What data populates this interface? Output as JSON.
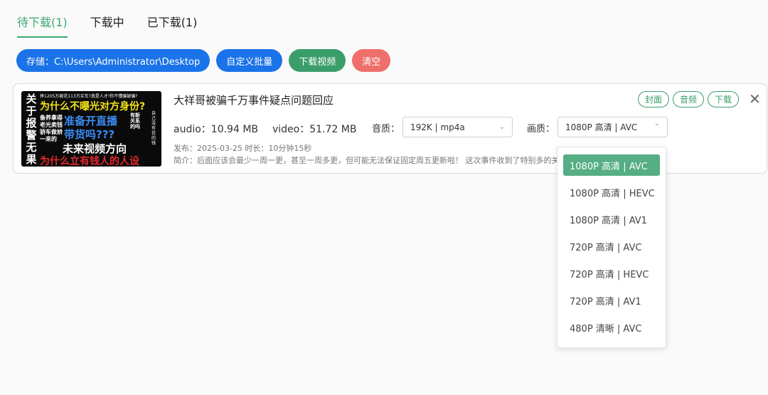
{
  "tabs": [
    {
      "label": "待下载(1)",
      "active": true
    },
    {
      "label": "下载中",
      "active": false
    },
    {
      "label": "已下载(1)",
      "active": false
    }
  ],
  "toolbar": {
    "storage_label": "存储：C:\\Users\\Administrator\\Desktop",
    "batch_label": "自定义批量",
    "download_label": "下载视频",
    "clear_label": "清空"
  },
  "item": {
    "title": "大祥哥被骗千万事件疑点问题回应",
    "tags": {
      "cover": "封面",
      "audio": "音频",
      "download": "下载"
    },
    "audio_size": "audio：10.94 MB",
    "video_size": "video：51.72 MB",
    "audio_quality_label": "音质：",
    "audio_quality_value": "192K | mp4a",
    "video_quality_label": "画质：",
    "video_quality_value": "1080P 高清 | AVC",
    "meta": "发布：2025-03-25 时长：10分钟15秒",
    "description": "简介：后面应该会最少一周一更，甚至一周多更，但可能无法保证固定周五更新啦！ 这次事件收到了特别多的关注和讨论，真的…",
    "thumbnail": {
      "side": "关于报警无果",
      "line1": "挣1205万被花113万买车?真是人才!你不懂骗被骗?",
      "line2": "为什么不曝光对方身份?",
      "cols": "备养拿得老光卖钱骄车做娇一来的",
      "line3": "准备开直播",
      "line4": "带货吗???",
      "line5": "未来视频方向",
      "rcol": "有新关系的吗",
      "rcol2": "自己没有花的钱",
      "line6": "为什么立有钱人的人设"
    }
  },
  "dropdown": {
    "options": [
      {
        "label": "1080P 高清 | AVC",
        "selected": true
      },
      {
        "label": "1080P 高清 | HEVC",
        "selected": false
      },
      {
        "label": "1080P 高清 | AV1",
        "selected": false
      },
      {
        "label": "720P 高清 | AVC",
        "selected": false
      },
      {
        "label": "720P 高清 | HEVC",
        "selected": false
      },
      {
        "label": "720P 高清 | AV1",
        "selected": false
      },
      {
        "label": "480P 清晰 | AVC",
        "selected": false
      }
    ]
  },
  "colors": {
    "accent": "#3a9e6a",
    "primary": "#1a73e8",
    "danger": "#ef6f6c"
  },
  "icons": {
    "close": "close-icon",
    "chevron": "chevron-down-icon"
  }
}
